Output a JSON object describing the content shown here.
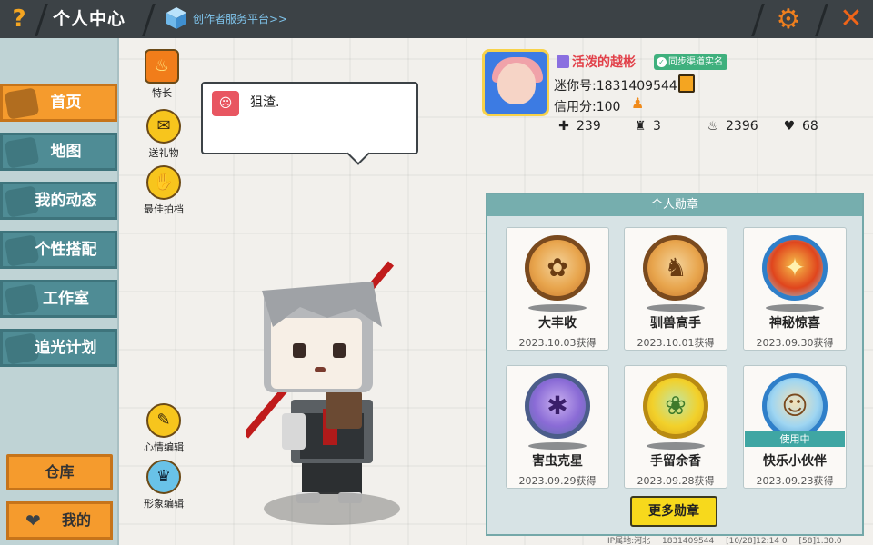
{
  "topbar": {
    "help": "?",
    "title": "个人中心",
    "creator_link": "创作者服务平台>>",
    "close": "✕"
  },
  "nav": {
    "items": [
      {
        "label": "首页"
      },
      {
        "label": "地图"
      },
      {
        "label": "我的动态"
      },
      {
        "label": "个性搭配"
      },
      {
        "label": "工作室"
      },
      {
        "label": "追光计划"
      }
    ],
    "warehouse": "仓库",
    "mine": "我的"
  },
  "side_actions": {
    "talent": "特长",
    "gift": "送礼物",
    "partner": "最佳拍档",
    "mood_edit": "心情编辑",
    "look_edit": "形象编辑"
  },
  "bubble": {
    "text": "狙渣."
  },
  "profile": {
    "name": "活泼的越彬",
    "verify_badge": "同步渠道实名",
    "mini_id": "迷你号:1831409544",
    "credit": "信用分:100",
    "stats": {
      "plus": "239",
      "trophy": "3",
      "fire": "2396",
      "hearts": "68"
    }
  },
  "medals": {
    "title": "个人勋章",
    "items": [
      {
        "name": "大丰收",
        "date": "2023.10.03获得",
        "glyph": "✿"
      },
      {
        "name": "驯兽高手",
        "date": "2023.10.01获得",
        "glyph": "♞"
      },
      {
        "name": "神秘惊喜",
        "date": "2023.09.30获得",
        "glyph": "✦"
      },
      {
        "name": "害虫克星",
        "date": "2023.09.29获得",
        "glyph": "✱"
      },
      {
        "name": "手留余香",
        "date": "2023.09.28获得",
        "glyph": "❀"
      },
      {
        "name": "快乐小伙伴",
        "date": "2023.09.23获得",
        "glyph": "☺",
        "badge": "使用中"
      }
    ],
    "more_button": "更多勋章"
  },
  "footer": {
    "ip": "IP属地:河北",
    "uid": "1831409544",
    "time": "[10/28]12:14 0",
    "version": "[58]1.30.0"
  }
}
